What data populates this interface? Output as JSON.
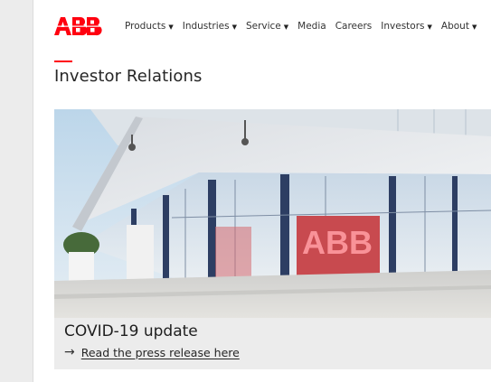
{
  "brand": {
    "logo_text": "ABB",
    "accent_color": "#ff000f"
  },
  "nav": {
    "items": [
      {
        "label": "Products",
        "has_dropdown": true
      },
      {
        "label": "Industries",
        "has_dropdown": true
      },
      {
        "label": "Service",
        "has_dropdown": true
      },
      {
        "label": "Media",
        "has_dropdown": false
      },
      {
        "label": "Careers",
        "has_dropdown": false
      },
      {
        "label": "Investors",
        "has_dropdown": true
      },
      {
        "label": "About",
        "has_dropdown": true
      }
    ],
    "dropdown_icon": "caret-down-icon"
  },
  "page": {
    "title": "Investor Relations"
  },
  "hero": {
    "image_subject": "building-storefront-photo",
    "caption_title": "COVID-19 update",
    "link_icon": "arrow-right-icon",
    "link_text": "Read the press release here"
  }
}
